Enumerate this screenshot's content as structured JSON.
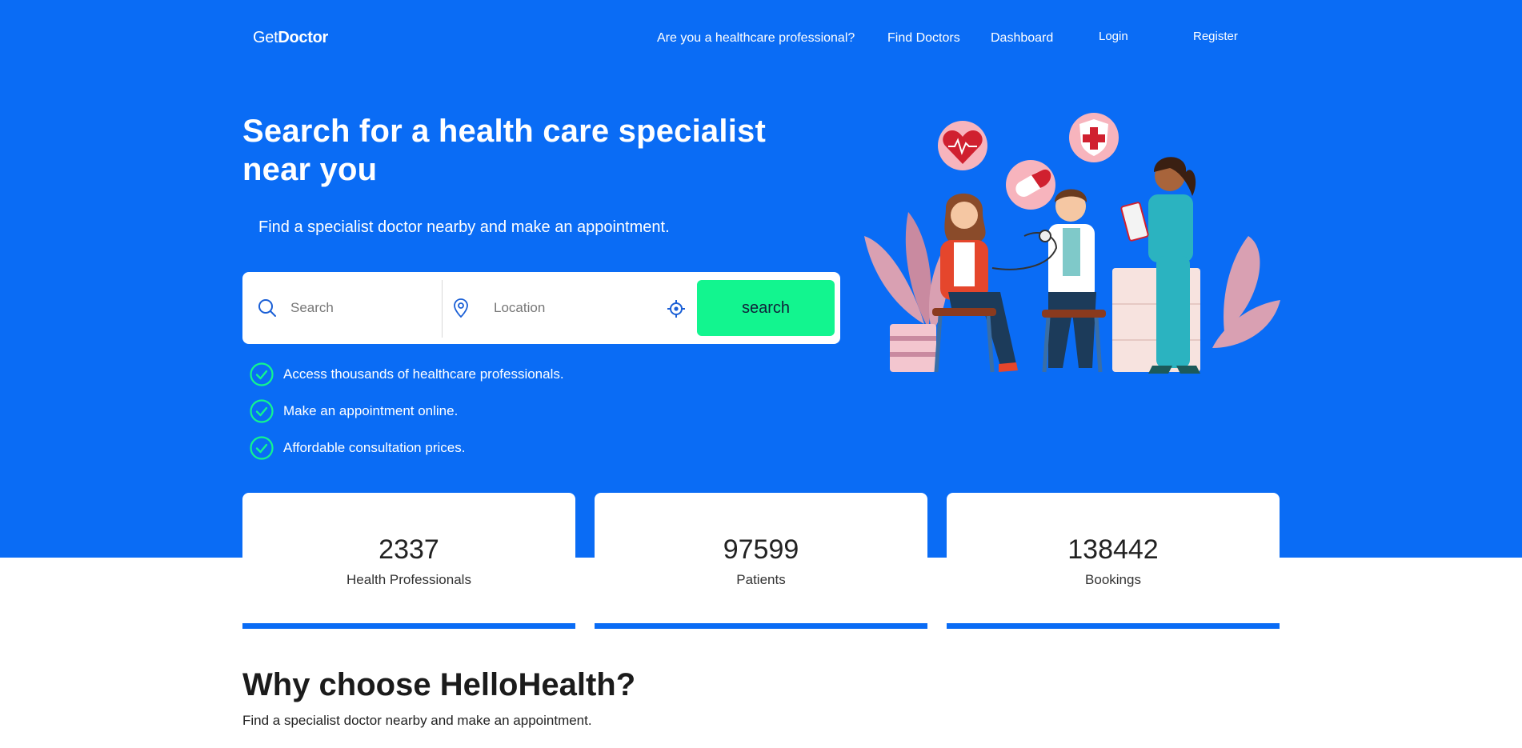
{
  "nav": {
    "logo_prefix": "Get",
    "logo_bold": "Doctor",
    "links": [
      {
        "label": "Are you a healthcare professional?"
      },
      {
        "label": "Find Doctors"
      },
      {
        "label": "Dashboard"
      },
      {
        "label": "Login"
      },
      {
        "label": "Register"
      }
    ]
  },
  "hero": {
    "title": "Search for a health care specialist near you",
    "subtitle": "Find a specialist doctor nearby and make an appointment."
  },
  "search": {
    "query_placeholder": "Search",
    "location_placeholder": "Location",
    "button_label": "search",
    "icons": [
      "search-icon",
      "map-pin-icon",
      "locate-target-icon"
    ]
  },
  "features": [
    {
      "text": "Access thousands of healthcare professionals."
    },
    {
      "text": "Make an appointment online."
    },
    {
      "text": "Affordable consultation prices."
    }
  ],
  "stats": [
    {
      "value": "2337",
      "label": "Health Professionals"
    },
    {
      "value": "97599",
      "label": "Patients"
    },
    {
      "value": "138442",
      "label": "Bookings"
    }
  ],
  "why": {
    "title": "Why choose HelloHealth?",
    "subtitle": "Find a specialist doctor nearby and make an appointment."
  },
  "colors": {
    "primary_blue": "#0a6cf5",
    "accent_green": "#12f58f",
    "white": "#ffffff"
  }
}
